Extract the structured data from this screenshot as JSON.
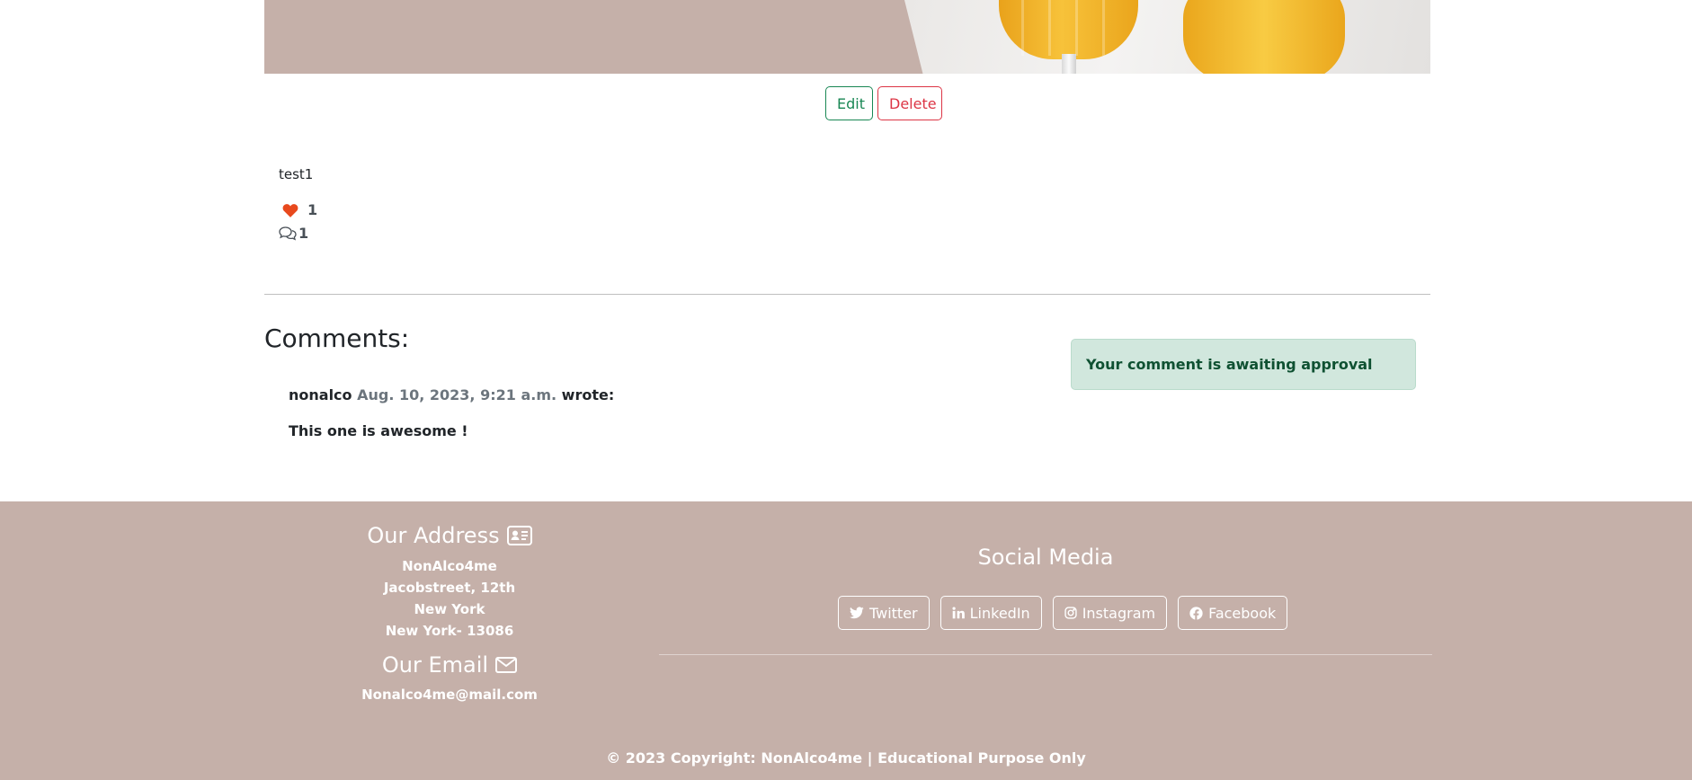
{
  "post": {
    "actions": {
      "edit_label": "Edit",
      "delete_label": "Delete"
    },
    "text": "test1",
    "likes_count": "1",
    "comments_count": "1"
  },
  "comments": {
    "title": "Comments:",
    "items": [
      {
        "author": "nonalco",
        "date": "Aug. 10, 2023, 9:21 a.m.",
        "wrote": "wrote:",
        "body": "This one is awesome !"
      }
    ],
    "alert": "Your comment is awaiting approval"
  },
  "footer": {
    "address_title": "Our Address",
    "address_lines": [
      "NonAlco4me",
      "Jacobstreet, 12th",
      "New York",
      "New York- 13086"
    ],
    "email_title": "Our Email",
    "email": "Nonalco4me@mail.com",
    "social_title": "Social Media",
    "social": [
      {
        "label": "Twitter",
        "icon": "twitter-icon"
      },
      {
        "label": "LinkedIn",
        "icon": "linkedin-icon"
      },
      {
        "label": "Instagram",
        "icon": "instagram-icon"
      },
      {
        "label": "Facebook",
        "icon": "facebook-icon"
      }
    ],
    "copyright": "© 2023 Copyright: NonAlco4me | Educational Purpose Only"
  },
  "colors": {
    "footer_bg": "#c5b0a9",
    "edit": "#198754",
    "delete": "#dc3545",
    "heart": "#e8491d",
    "alert_bg": "#d1e7dd",
    "alert_text": "#0f5132"
  }
}
